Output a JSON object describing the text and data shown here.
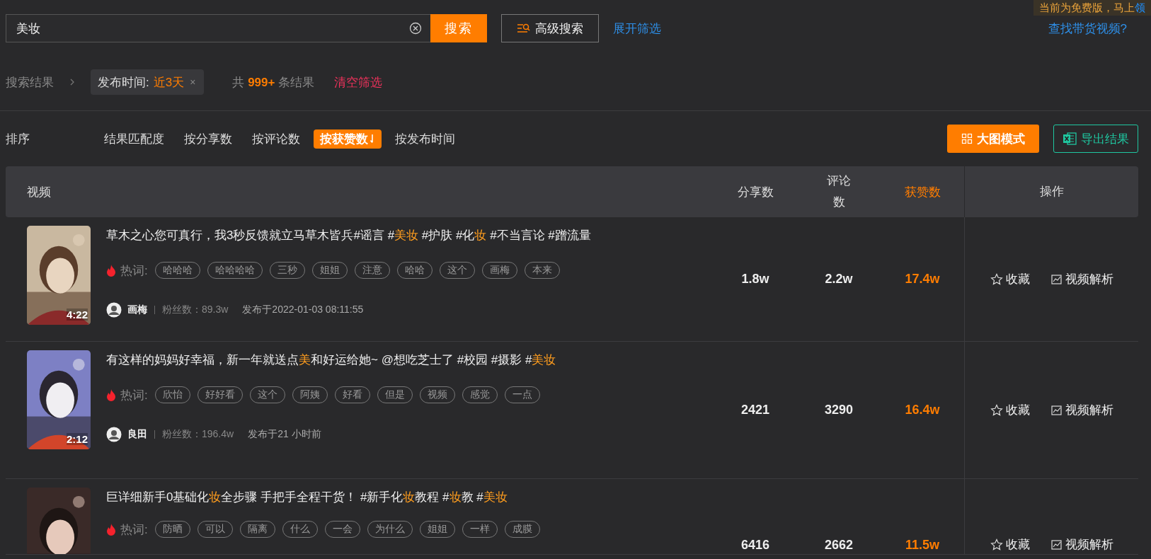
{
  "promo_banner": {
    "text": "当前为免费版，马上",
    "link": "领"
  },
  "search": {
    "value": "美妆",
    "button": "搜索"
  },
  "advanced_search": {
    "label": "高级搜索"
  },
  "expand_filter": "展开筛选",
  "find_goods_video": "查找带货视频?",
  "filter_bar": {
    "crumb": "搜索结果",
    "chip_label": "发布时间:",
    "chip_value": "近3天",
    "chip_close": "×",
    "total_prefix": "共",
    "total_count": "999+",
    "total_suffix": "条结果",
    "clear": "清空筛选"
  },
  "sort": {
    "label": "排序",
    "options": [
      {
        "label": "结果匹配度",
        "selected": false
      },
      {
        "label": "按分享数",
        "selected": false
      },
      {
        "label": "按评论数",
        "selected": false
      },
      {
        "label": "按获赞数",
        "selected": true
      },
      {
        "label": "按发布时间",
        "selected": false
      }
    ]
  },
  "view_button": "大图模式",
  "export_button": "导出结果",
  "table": {
    "columns": [
      {
        "label": "视频",
        "sorted": false
      },
      {
        "label": "分享数",
        "sorted": false
      },
      {
        "label": "评论数",
        "sorted": false
      },
      {
        "label": "获赞数",
        "sorted": true
      },
      {
        "label": "操作",
        "sorted": false
      }
    ],
    "rows": [
      {
        "thumbnail": {
          "kind": "picture",
          "duration": "4:22"
        },
        "title": [
          {
            "text": "草木之心您可真行，我3秒反馈就立马草木皆兵#谣言 #",
            "highlight": false
          },
          {
            "text": "美妆",
            "highlight": true
          },
          {
            "text": " #护肤 #化",
            "highlight": false
          },
          {
            "text": "妆",
            "highlight": true
          },
          {
            "text": " #不当言论 #蹭流量",
            "highlight": false
          }
        ],
        "hot_label": "热词:",
        "hot_words": [
          "哈哈哈",
          "哈哈哈哈",
          "三秒",
          "姐姐",
          "注意",
          "哈哈",
          "这个",
          "画梅",
          "本来"
        ],
        "author": {
          "name": "画梅",
          "fans": "粉丝数：89.3w",
          "published": "发布于2022-01-03 08:11:55"
        },
        "shares": "1.8w",
        "comments": "2.2w",
        "likes": "17.4w",
        "favorite": "收藏",
        "analyze": "视频解析"
      },
      {
        "thumbnail": {
          "kind": "picture",
          "duration": "2:12"
        },
        "title": [
          {
            "text": "有这样的妈妈好幸福，新一年就送点",
            "highlight": false
          },
          {
            "text": "美",
            "highlight": true
          },
          {
            "text": "和好运给她~ @想吃芝士了 #校园 #摄影 #",
            "highlight": false
          },
          {
            "text": "美妆",
            "highlight": true
          }
        ],
        "hot_label": "热词:",
        "hot_words": [
          "欣怡",
          "好好看",
          "这个",
          "阿姨",
          "好看",
          "但是",
          "视频",
          "感觉",
          "一点"
        ],
        "author": {
          "name": "良田",
          "fans": "粉丝数：196.4w",
          "published": "发布于21 小时前"
        },
        "shares": "2421",
        "comments": "3290",
        "likes": "16.4w",
        "favorite": "收藏",
        "analyze": "视频解析"
      },
      {
        "thumbnail": {
          "kind": "picture"
        },
        "title": [
          {
            "text": "巨详细新手0基础化",
            "highlight": false
          },
          {
            "text": "妆",
            "highlight": true
          },
          {
            "text": "全步骤 手把手全程干货！ #新手化",
            "highlight": false
          },
          {
            "text": "妆",
            "highlight": true
          },
          {
            "text": "教程 #",
            "highlight": false
          },
          {
            "text": "妆",
            "highlight": true
          },
          {
            "text": "教 #",
            "highlight": false
          },
          {
            "text": "美妆",
            "highlight": true
          }
        ],
        "hot_label": "热词:",
        "hot_words": [
          "防晒",
          "可以",
          "隔离",
          "什么",
          "一会",
          "为什么",
          "姐姐",
          "一样",
          "成膜"
        ],
        "shares": "6416",
        "comments": "2662",
        "likes": "11.5w",
        "favorite": "收藏",
        "analyze": "视频解析"
      }
    ]
  }
}
